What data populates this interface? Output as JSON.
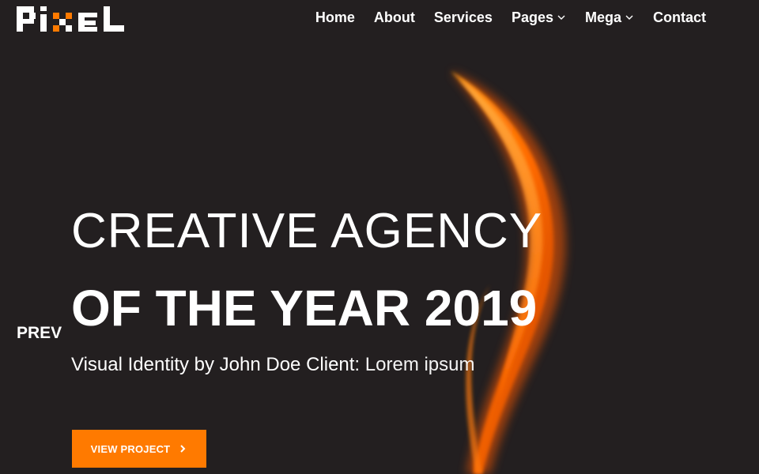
{
  "header": {
    "logo_text": "pixel",
    "nav": [
      {
        "label": "Home",
        "dropdown": false
      },
      {
        "label": "About",
        "dropdown": false
      },
      {
        "label": "Services",
        "dropdown": false
      },
      {
        "label": "Pages",
        "dropdown": true
      },
      {
        "label": "Mega",
        "dropdown": true
      },
      {
        "label": "Contact",
        "dropdown": false
      }
    ]
  },
  "hero": {
    "headline_line1": "CREATIVE AGENCY",
    "headline_line2": "OF THE YEAR 2019",
    "subtitle_main": "Visual Identity by John Doe Client:",
    "subtitle_tail": " Lorem ipsum",
    "prev_label": "PREV",
    "cta_label": "VIEW PROJECT"
  },
  "colors": {
    "background": "#231f20",
    "accent": "#ff7a00",
    "text": "#ffffff"
  },
  "icons": {
    "nav_dropdown": "chevron-down-icon",
    "cta": "chevron-right-icon",
    "hero_image": "flame-image"
  }
}
